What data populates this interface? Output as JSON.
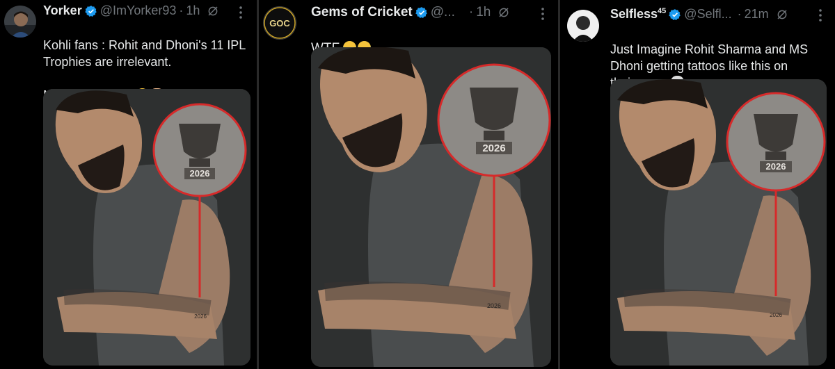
{
  "tweets": [
    {
      "name": "Yorker",
      "handle": "@ImYorker93",
      "separator": "·",
      "time": "1h",
      "text": "Kohli fans : Rohit and Dhoni's 11 IPL\nTrophies are irrelevant.\n\nMeanwhile Kohli",
      "emojis": [
        "loudly-crying-face",
        "folded-hands"
      ],
      "tattoo_year": "2026",
      "arm_year": "2026"
    },
    {
      "name": "Gems of Cricket",
      "handle": "@...",
      "separator": "·",
      "time": "1h",
      "avatar_text": "GOC",
      "text": "WTF.",
      "emojis": [
        "loudly-crying-face",
        "loudly-crying-face"
      ],
      "tattoo_year": "2026",
      "arm_year": "2026"
    },
    {
      "name": "Selfless",
      "name_suffix": "45",
      "handle": "@Selfl...",
      "separator": "·",
      "time": "21m",
      "text": "Just Imagine Rohit Sharma and MS\nDhoni getting tattoos like this on\ntheir arms.",
      "emojis": [
        "skull"
      ],
      "tattoo_year": "2026",
      "arm_year": "2026"
    }
  ],
  "colors": {
    "background": "#000000",
    "text": "#e7e9ea",
    "muted": "#71767b",
    "verified": "#1d9bf0",
    "callout_line": "#d62a2a"
  },
  "icons": [
    "verified-badge-icon",
    "muted-icon",
    "more-icon"
  ]
}
